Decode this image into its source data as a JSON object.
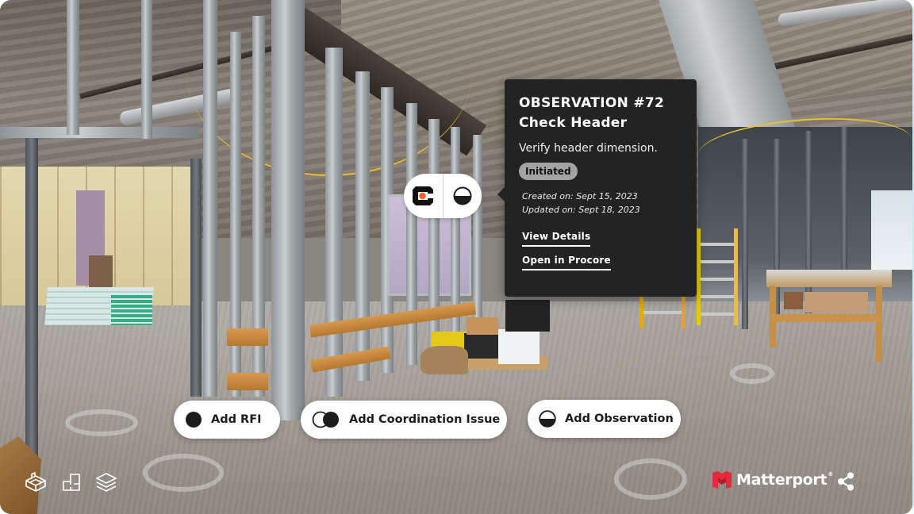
{
  "viewer": {
    "scene": "construction site interior 3D tour",
    "brand_color": "#e8283c"
  },
  "pin": {
    "left_icon": "procore-icon",
    "right_icon": "observation-icon",
    "procore_accent": "#f26322"
  },
  "observation_card": {
    "title_line1": "OBSERVATION #72",
    "title_line2": "Check Header",
    "description": "Verify header dimension.",
    "status": "Initiated",
    "created": "Created on: Sept 15, 2023",
    "updated": "Updated on: Sept 18, 2023",
    "view_details_label": "View Details",
    "open_in_procore_label": "Open in Procore"
  },
  "actions": [
    {
      "label": "Add RFI",
      "icon": "filled-circle-icon"
    },
    {
      "label": "Add Coordination Issue",
      "icon": "overlapping-circles-icon"
    },
    {
      "label": "Add Observation",
      "icon": "half-filled-circle-icon"
    }
  ],
  "toolbar": {
    "items": [
      {
        "name": "dollhouse-view",
        "icon": "dollhouse-icon"
      },
      {
        "name": "floor-plan-view",
        "icon": "floorplan-icon"
      },
      {
        "name": "floor-selector",
        "icon": "layers-icon"
      }
    ]
  },
  "branding": {
    "name": "Matterport",
    "mark": "®"
  },
  "share": {
    "icon": "share-icon"
  }
}
